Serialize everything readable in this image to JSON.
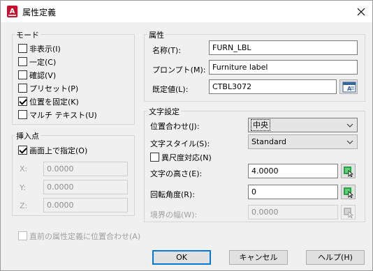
{
  "window": {
    "title": "属性定義"
  },
  "mode": {
    "label": "モード",
    "options": [
      {
        "label": "非表示(I)",
        "checked": false
      },
      {
        "label": "一定(C)",
        "checked": false
      },
      {
        "label": "確認(V)",
        "checked": false
      },
      {
        "label": "プリセット(P)",
        "checked": false
      },
      {
        "label": "位置を固定(K)",
        "checked": true
      },
      {
        "label": "マルチ テキスト(U)",
        "checked": false
      }
    ]
  },
  "attribute": {
    "label": "属性",
    "tag_label": "名称(T):",
    "tag_value": "FURN_LBL",
    "prompt_label": "プロンプト(M):",
    "prompt_value": "Furniture label",
    "default_label": "既定値(L):",
    "default_value": "CTBL3072"
  },
  "insertion": {
    "label": "挿入点",
    "specify_on_screen": "画面上で指定(O)",
    "specify_checked": true,
    "x_label": "X:",
    "x_value": "0.0000",
    "y_label": "Y:",
    "y_value": "0.0000",
    "z_label": "Z:",
    "z_value": "0.0000"
  },
  "text_settings": {
    "label": "文字設定",
    "justification_label": "位置合わせ(J):",
    "justification_value": "中央",
    "style_label": "文字スタイル(S):",
    "style_value": "Standard",
    "annotative_label": "異尺度対応(N)",
    "annotative_checked": false,
    "height_label": "文字の高さ(E):",
    "height_value": "4.0000",
    "rotation_label": "回転角度(R):",
    "rotation_value": "0",
    "boundary_label": "境界の幅(W):",
    "boundary_value": "0.0000"
  },
  "align_below": {
    "label": "直前の属性定義に位置合わせ(A)",
    "checked": false
  },
  "buttons": {
    "ok": "OK",
    "cancel": "キャンセル",
    "help": "ヘルプ(H)"
  },
  "colors": {
    "accent": "#0078d7",
    "brand": "#c8102e"
  }
}
